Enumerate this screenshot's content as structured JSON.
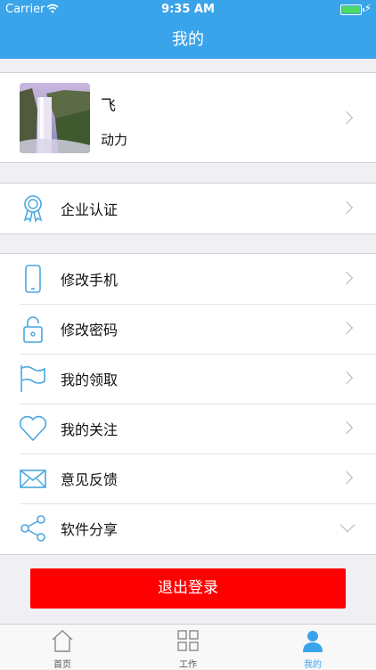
{
  "status_bar": {
    "carrier": "Carrier",
    "time": "9:35 AM"
  },
  "nav": {
    "title": "我的"
  },
  "profile": {
    "name": "飞",
    "subtitle": "动力"
  },
  "certification": {
    "label": "企业认证",
    "icon": "certificate-icon"
  },
  "menu": [
    {
      "label": "修改手机",
      "icon": "phone-icon"
    },
    {
      "label": "修改密码",
      "icon": "lock-icon"
    },
    {
      "label": "我的领取",
      "icon": "flag-icon"
    },
    {
      "label": "我的关注",
      "icon": "heart-icon"
    },
    {
      "label": "意见反馈",
      "icon": "mail-icon"
    },
    {
      "label": "软件分享",
      "icon": "share-icon"
    }
  ],
  "logout": {
    "label": "退出登录"
  },
  "tabbar": [
    {
      "label": "首页",
      "icon": "home-icon"
    },
    {
      "label": "工作",
      "icon": "grid-icon"
    },
    {
      "label": "我的",
      "icon": "person-icon",
      "active": true
    }
  ],
  "colors": {
    "accent": "#3aa4ea",
    "logout": "#ff0000",
    "icon_blue": "#4aa6e0"
  }
}
